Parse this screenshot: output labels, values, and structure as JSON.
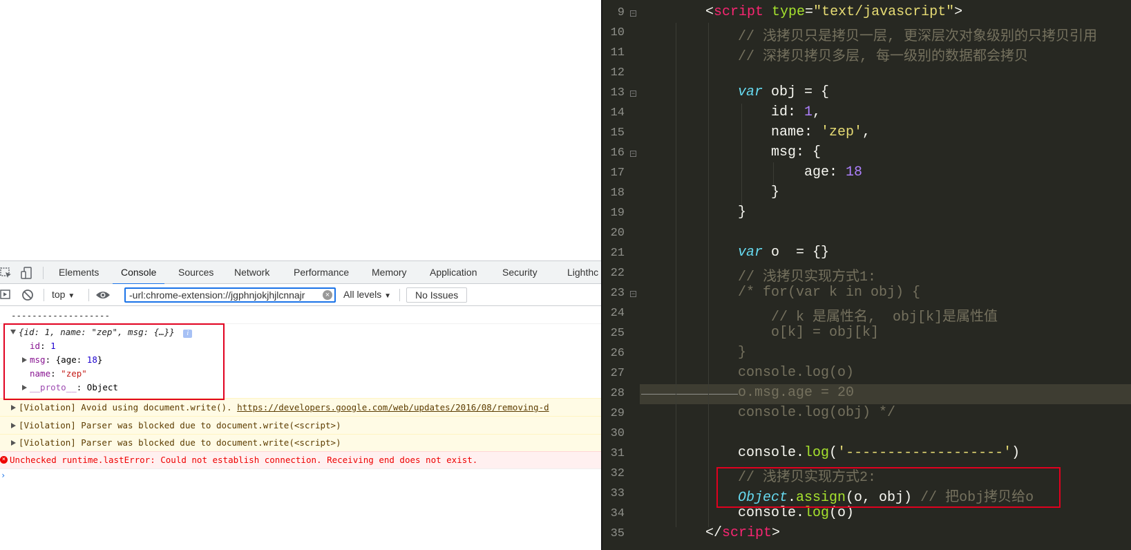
{
  "devtools": {
    "tabs": [
      "Elements",
      "Console",
      "Sources",
      "Network",
      "Performance",
      "Memory",
      "Application",
      "Security",
      "Lighthc"
    ],
    "active_tab": "Console",
    "context": "top",
    "filter_value": "-url:chrome-extension://jgphnjokjhjlcnnajr",
    "levels": "All levels",
    "issues": "No Issues"
  },
  "console": {
    "separator": "-------------------",
    "object_preview": "{id: 1, name: \"zep\", msg: {…}}",
    "id_key": "id",
    "id_val": "1",
    "msg_key": "msg",
    "msg_val_pre": "{age: ",
    "msg_val_num": "18",
    "msg_val_post": "}",
    "name_key": "name",
    "name_val": "\"zep\"",
    "proto_key": "__proto__",
    "proto_val": "Object",
    "warn1_text": "[Violation] Avoid using document.write(). ",
    "warn1_link": "https://developers.google.com/web/updates/2016/08/removing-d",
    "warn2_text": "[Violation] Parser was blocked due to document.write(<script>)",
    "warn3_text": "[Violation] Parser was blocked due to document.write(<script>)",
    "error_text": "Unchecked runtime.lastError: Could not establish connection. Receiving end does not exist."
  },
  "editor": {
    "line_numbers": [
      "9",
      "10",
      "11",
      "12",
      "13",
      "14",
      "15",
      "16",
      "17",
      "18",
      "19",
      "20",
      "21",
      "22",
      "23",
      "24",
      "25",
      "26",
      "27",
      "28",
      "29",
      "30",
      "31",
      "32",
      "33",
      "34",
      "35"
    ],
    "l9_open": "<",
    "l9_tag": "script",
    "l9_attr": " type",
    "l9_eq": "=",
    "l9_str": "\"text/javascript\"",
    "l9_close": ">",
    "l10": "// 浅拷贝只是拷贝一层, 更深层次对象级别的只拷贝引用",
    "l11": "// 深拷贝拷贝多层, 每一级别的数据都会拷贝",
    "l13_kw": "var",
    "l13_rest": " obj = {",
    "l14_key": "id: ",
    "l14_num": "1",
    "l14_end": ",",
    "l15_key": "name: ",
    "l15_str": "'zep'",
    "l15_end": ",",
    "l16": "msg: {",
    "l17_key": "age: ",
    "l17_num": "18",
    "l18": "}",
    "l19": "}",
    "l21_kw": "var",
    "l21_rest": " o  = {}",
    "l22": "// 浅拷贝实现方式1:",
    "l23": "/* for(var k in obj) {",
    "l24": "// k 是属性名,  obj[k]是属性值",
    "l25": "o[k] = obj[k]",
    "l26": "}",
    "l27": "console.log(o)",
    "l28": "o.msg.age = 20",
    "l29": "console.log(obj) */",
    "l31_obj": "console",
    "l31_dot": ".",
    "l31_fn": "log",
    "l31_open": "(",
    "l31_str": "'-------------------'",
    "l31_close": ")",
    "l32": "// 浅拷贝实现方式2:",
    "l33_obj": "Object",
    "l33_dot": ".",
    "l33_fn": "assign",
    "l33_args": "(o, obj) ",
    "l33_cmt": "// 把obj拷贝给o",
    "l34_obj": "console",
    "l34_dot": ".",
    "l34_fn": "log",
    "l34_args": "(o)",
    "l35_open": "</",
    "l35_tag": "script",
    "l35_close": ">"
  }
}
